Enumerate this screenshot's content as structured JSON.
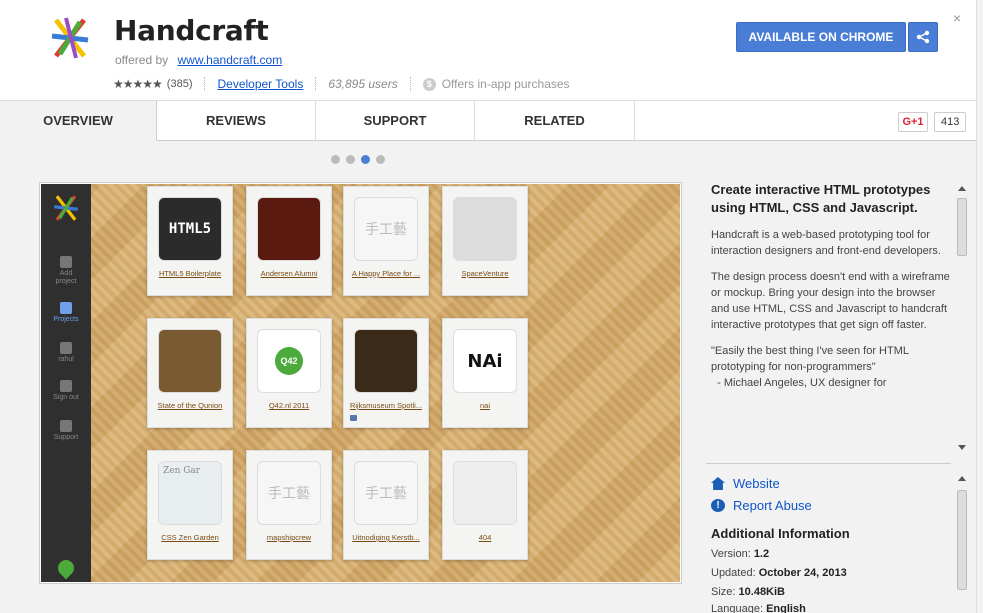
{
  "header": {
    "app_title": "Handcraft",
    "offered_by_label": "offered by",
    "offered_by_link": "www.handcraft.com",
    "stars": "★★★★★",
    "rating_count": "(385)",
    "category": "Developer Tools",
    "users": "63,895 users",
    "coin_symbol": "$",
    "in_app": "Offers in-app purchases",
    "install_label": "AVAILABLE ON CHROME",
    "close_symbol": "×"
  },
  "tabs": [
    "OVERVIEW",
    "REVIEWS",
    "SUPPORT",
    "RELATED"
  ],
  "gplus": {
    "label": "G+1",
    "count": "413"
  },
  "carousel": {
    "active_index": 2,
    "count": 4
  },
  "screenshot": {
    "sidebar": [
      {
        "label1": "Add",
        "label2": "project",
        "icon": "plus-icon"
      },
      {
        "label1": "Projects",
        "label2": "",
        "icon": "edit-icon"
      },
      {
        "label1": "rahul",
        "label2": "",
        "icon": "user-icon"
      },
      {
        "label1": "Sign out",
        "label2": "",
        "icon": "signout-icon"
      },
      {
        "label1": "Support",
        "label2": "",
        "icon": "help-icon"
      }
    ],
    "projects": [
      {
        "name": "HTML5 Boilerplate",
        "thumb_text": "HTML5"
      },
      {
        "name": "Andersen Alumni",
        "thumb_text": ""
      },
      {
        "name": "A Happy Place for ...",
        "thumb_text": "手工藝"
      },
      {
        "name": "SpaceVenture",
        "thumb_text": ""
      },
      {
        "name": "State of the Qunion",
        "thumb_text": ""
      },
      {
        "name": "Q42.nl 2011",
        "thumb_text": "Q42"
      },
      {
        "name": "Rijksmuseum Spotli...",
        "thumb_text": ""
      },
      {
        "name": "nai",
        "thumb_text": "NAi"
      },
      {
        "name": "CSS Zen Garden",
        "thumb_text": "Zen Gar"
      },
      {
        "name": "mapshipcrew",
        "thumb_text": "手工藝"
      },
      {
        "name": "Uitnodiging Kerstb...",
        "thumb_text": "手工藝"
      },
      {
        "name": "404",
        "thumb_text": ""
      }
    ]
  },
  "description": {
    "heading": "Create interactive HTML prototypes using HTML, CSS and Javascript.",
    "para1": "Handcraft is a web-based prototyping tool for interaction designers and front-end developers.",
    "para2": "The design process doesn't end with a wireframe or mockup. Bring your design into the browser and use HTML, CSS and Javascript to handcraft interactive prototypes that get sign off faster.",
    "para3": "\"Easily the best thing I've seen for HTML prototyping for non-programmers\"",
    "para4": "  - Michael Angeles, UX designer for"
  },
  "links": {
    "website": "Website",
    "report_abuse": "Report Abuse"
  },
  "additional_info": {
    "title": "Additional Information",
    "version_label": "Version:",
    "version": "1.2",
    "updated_label": "Updated:",
    "updated": "October 24, 2013",
    "size_label": "Size:",
    "size": "10.48KiB",
    "language_label": "Language:",
    "language": "English"
  },
  "colors": {
    "accent": "#4a7ed6",
    "link": "#1155cc",
    "gplus_red": "#dd2233"
  }
}
